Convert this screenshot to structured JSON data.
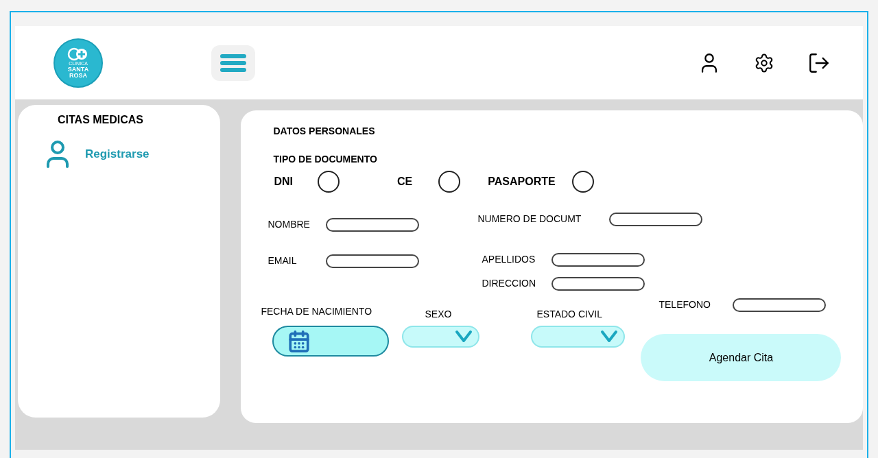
{
  "logo": {
    "lines": [
      "CLINICA",
      "SANTA",
      "ROSA"
    ]
  },
  "sidebar": {
    "title": "CITAS MEDICAS",
    "items": [
      {
        "label": "Registrarse"
      }
    ]
  },
  "form": {
    "title": "DATOS PERSONALES",
    "document_type": {
      "label": "TIPO DE DOCUMENTO",
      "options": [
        {
          "label": "DNI",
          "selected": false
        },
        {
          "label": "CE",
          "selected": false
        },
        {
          "label": "PASAPORTE",
          "selected": false
        }
      ]
    },
    "left_fields": [
      {
        "label": "NOMBRE"
      },
      {
        "label": "EMAIL"
      }
    ],
    "right_fields": [
      {
        "label": "NUMERO DE DOCUMT"
      },
      {
        "label": "APELLIDOS"
      },
      {
        "label": "DIRECCION"
      }
    ],
    "birth_date": {
      "label": "FECHA DE NACIMIENTO"
    },
    "selects": [
      {
        "label": "SEXO"
      },
      {
        "label": "ESTADO CIVIL"
      }
    ],
    "phone": {
      "label": "TELEFONO"
    },
    "submit": "Agendar Cita"
  }
}
